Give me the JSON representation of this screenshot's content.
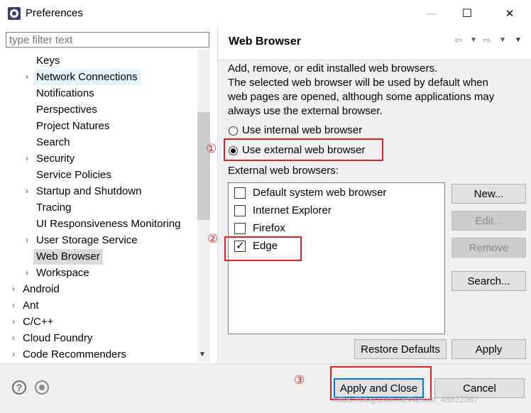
{
  "window": {
    "title": "Preferences",
    "minimize": "—",
    "maximize": "☐",
    "close": "✕"
  },
  "filter": {
    "placeholder": "type filter text"
  },
  "tree": {
    "items": [
      {
        "label": "Keys",
        "arrow": ""
      },
      {
        "label": "Network Connections",
        "arrow": "›"
      },
      {
        "label": "Notifications",
        "arrow": ""
      },
      {
        "label": "Perspectives",
        "arrow": ""
      },
      {
        "label": "Project Natures",
        "arrow": ""
      },
      {
        "label": "Search",
        "arrow": ""
      },
      {
        "label": "Security",
        "arrow": "›"
      },
      {
        "label": "Service Policies",
        "arrow": ""
      },
      {
        "label": "Startup and Shutdown",
        "arrow": "›"
      },
      {
        "label": "Tracing",
        "arrow": ""
      },
      {
        "label": "UI Responsiveness Monitoring",
        "arrow": ""
      },
      {
        "label": "User Storage Service",
        "arrow": "›"
      },
      {
        "label": "Web Browser",
        "arrow": ""
      },
      {
        "label": "Workspace",
        "arrow": "›"
      },
      {
        "label": "Android",
        "arrow": "›"
      },
      {
        "label": "Ant",
        "arrow": "›"
      },
      {
        "label": "C/C++",
        "arrow": "›"
      },
      {
        "label": "Cloud Foundry",
        "arrow": "›"
      },
      {
        "label": "Code Recommenders",
        "arrow": "›"
      }
    ]
  },
  "page": {
    "title": "Web Browser",
    "description": [
      "Add, remove, or edit installed web browsers.",
      "The selected web browser will be used by default when",
      "web pages are opened, although some applications may",
      "always use the external browser."
    ],
    "radio_internal": "Use internal web browser",
    "radio_external": "Use external web browser",
    "list_label": "External web browsers:",
    "browsers": [
      {
        "label": "Default system web browser",
        "checked": false
      },
      {
        "label": "Internet Explorer",
        "checked": false
      },
      {
        "label": "Firefox",
        "checked": false
      },
      {
        "label": "Edge",
        "checked": true
      }
    ],
    "buttons": {
      "new": "New...",
      "edit": "Edit...",
      "remove": "Remove",
      "search": "Search..."
    },
    "restore_defaults": "Restore Defaults",
    "apply": "Apply"
  },
  "footer": {
    "help": "?",
    "apply_close": "Apply and Close",
    "cancel": "Cancel"
  },
  "annotations": {
    "one": "①",
    "two": "②",
    "three": "③"
  },
  "watermark": "https://blog.csdn.net/weixin_46822367",
  "colors": {
    "annotation_red": "#d9232b",
    "accent_blue": "#0078d7"
  }
}
